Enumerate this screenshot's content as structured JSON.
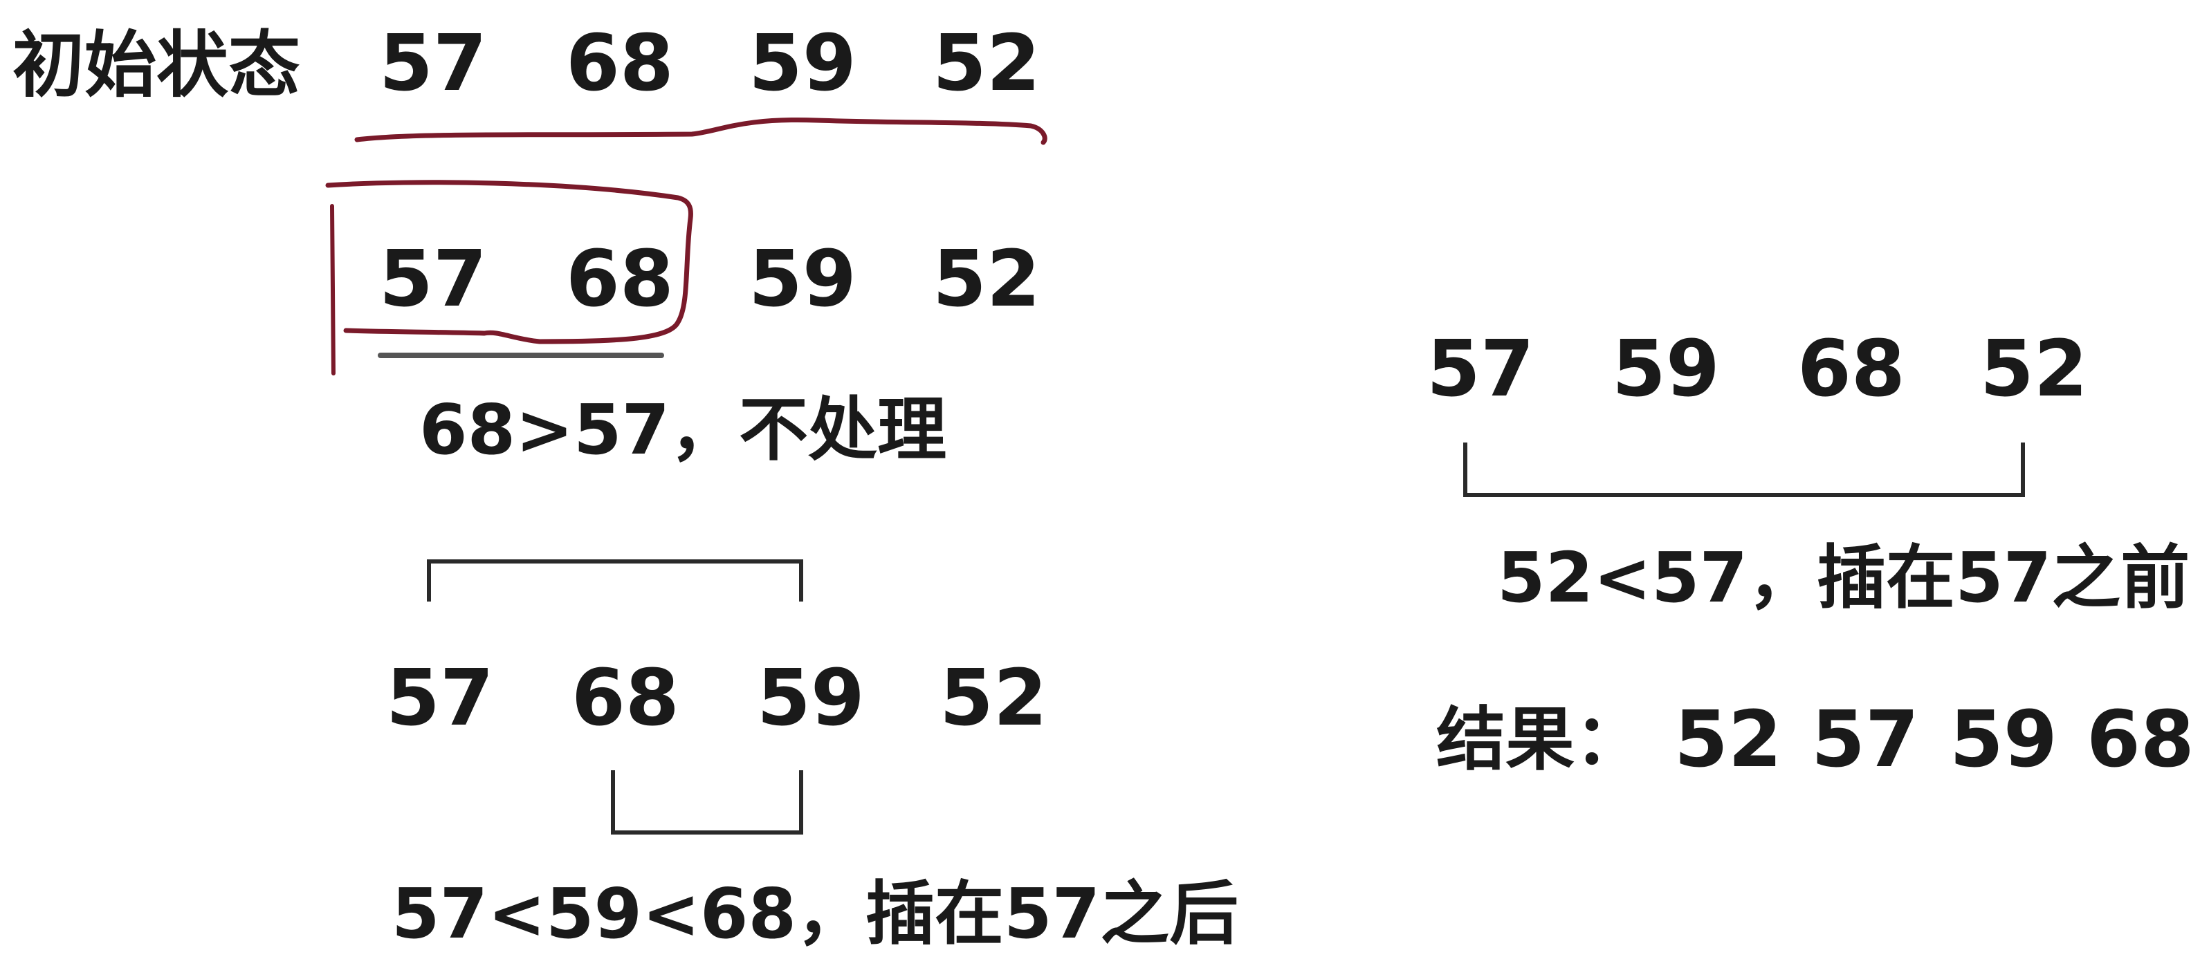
{
  "title": "初始状态",
  "rows": [
    {
      "id": "row1",
      "values": [
        "57",
        "68",
        "59",
        "52"
      ]
    },
    {
      "id": "row2",
      "values": [
        "57",
        "68",
        "59",
        "52"
      ]
    },
    {
      "id": "row3",
      "values": [
        "57",
        "68",
        "59",
        "52"
      ]
    },
    {
      "id": "row4",
      "values": [
        "57",
        "59",
        "68",
        "52"
      ]
    }
  ],
  "notes": {
    "step1": "68>57，不处理",
    "step2": "57<59<68，插在57之后",
    "step3": "52<57，插在57之前"
  },
  "result": {
    "label": "结果：",
    "values": [
      "52",
      "57",
      "59",
      "68"
    ]
  },
  "colors": {
    "ink": "#1a1a1a",
    "red_pen": "#7a1a2a",
    "dark_pen": "#3a3a3a"
  }
}
